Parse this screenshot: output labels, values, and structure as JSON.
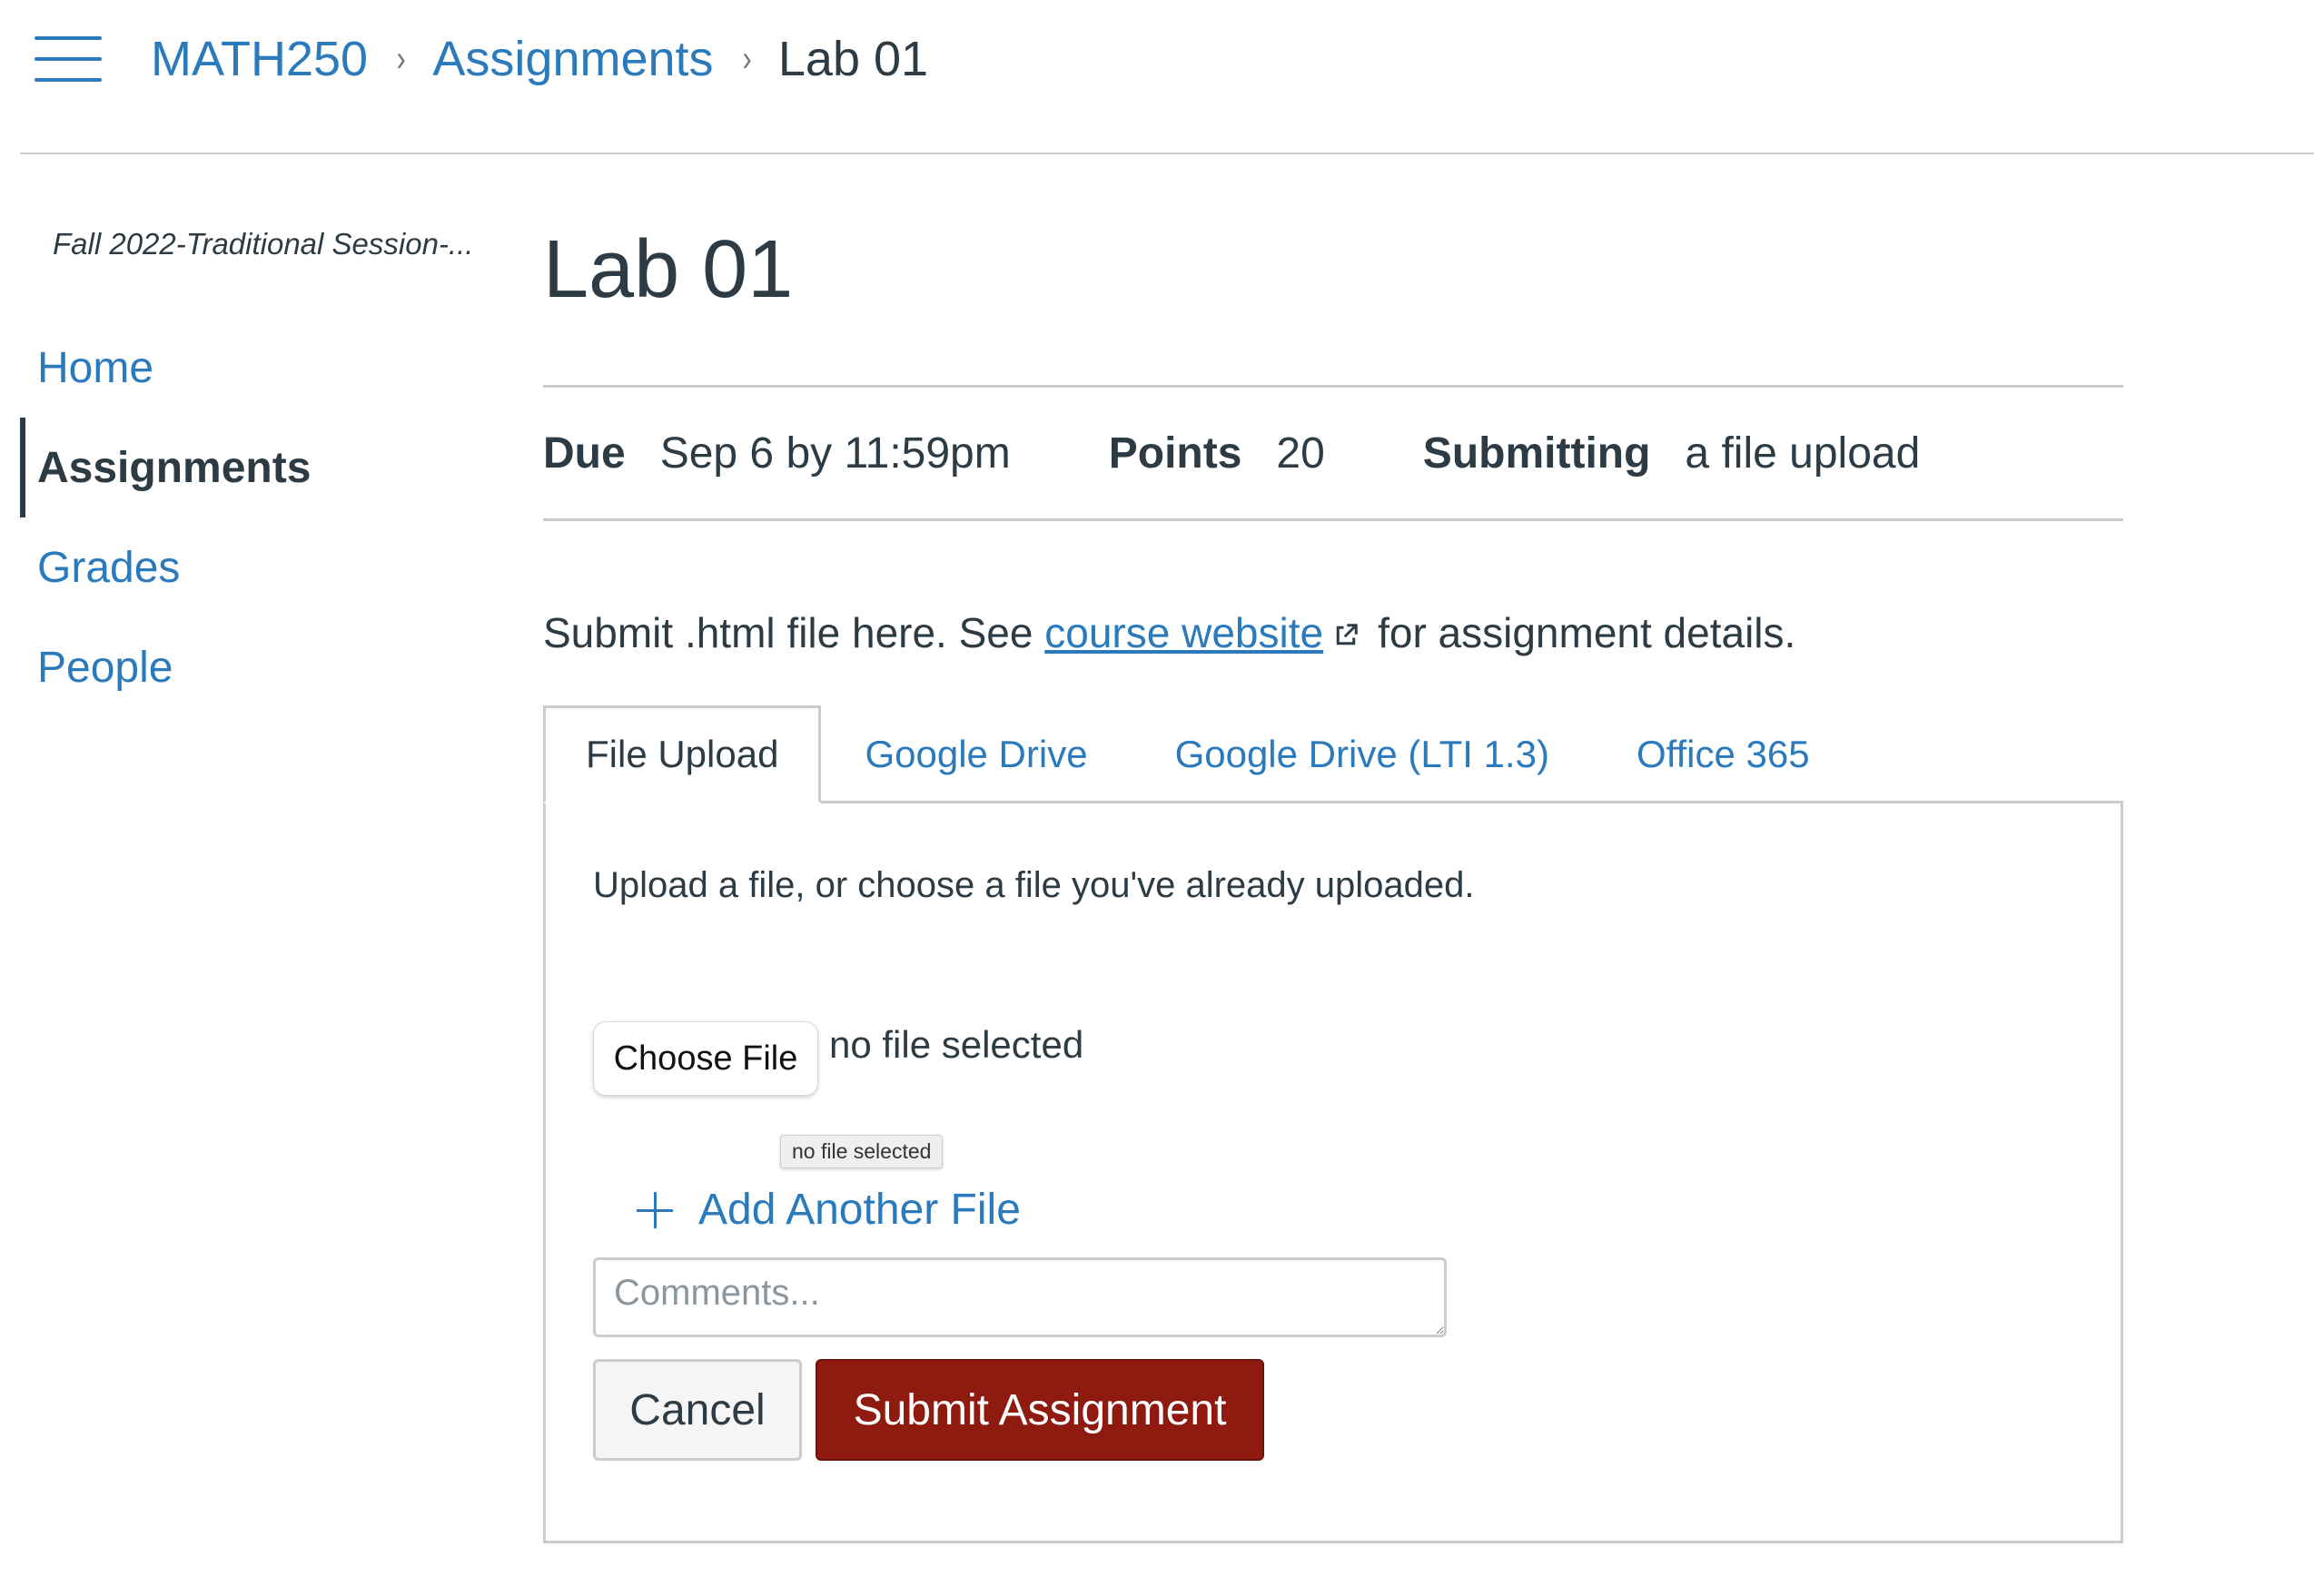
{
  "header": {
    "menu_icon": "hamburger-menu-icon",
    "breadcrumb": [
      "MATH250",
      "Assignments",
      "Lab 01"
    ],
    "separator_glyph": "›",
    "accent_color": "#2b7abc"
  },
  "course_nav": {
    "term": "Fall 2022-Traditional Session-...",
    "items": [
      {
        "label": "Home",
        "active": false
      },
      {
        "label": "Assignments",
        "active": true
      },
      {
        "label": "Grades",
        "active": false
      },
      {
        "label": "People",
        "active": false
      }
    ]
  },
  "assignment": {
    "title": "Lab 01",
    "due_label": "Due",
    "due_value": "Sep 6 by 11:59pm",
    "points_label": "Points",
    "points_value": "20",
    "submitting_label": "Submitting",
    "submitting_value": "a file upload",
    "instructions_before": "Submit .html file here. See",
    "instructions_link": "course website",
    "external_link_icon": "external-link-icon",
    "instructions_after": "for assignment details."
  },
  "submission": {
    "tabs": [
      "File Upload",
      "Google Drive",
      "Google Drive (LTI 1.3)",
      "Office 365"
    ],
    "active_tab": "File Upload",
    "upload_hint": "Upload a file, or choose a file you've already uploaded.",
    "choose_file_label": "Choose File",
    "file_status": "no file selected",
    "tooltip": "no file selected",
    "add_file_label": "Add Another File",
    "add_file_icon": "plus-icon",
    "comments_placeholder": "Comments...",
    "cancel_label": "Cancel",
    "submit_label": "Submit Assignment",
    "submit_color": "#8e1a10"
  }
}
